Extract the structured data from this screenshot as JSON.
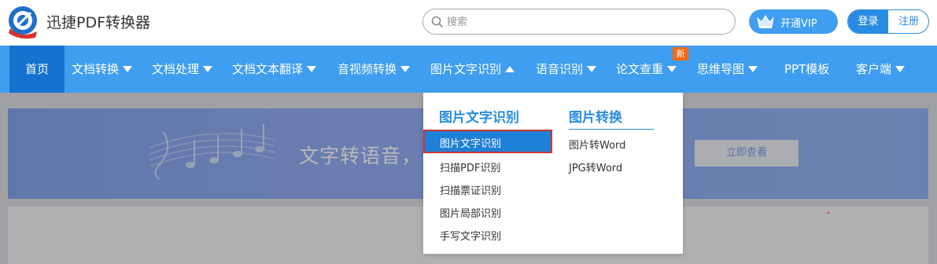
{
  "header": {
    "app_title": "迅捷PDF转换器",
    "search_placeholder": "搜索",
    "vip_label": "开通VIP",
    "login_label": "登录",
    "register_label": "注册"
  },
  "nav": {
    "items": [
      {
        "label": "首页",
        "dropdown": false
      },
      {
        "label": "文档转换",
        "dropdown": true
      },
      {
        "label": "文档处理",
        "dropdown": true
      },
      {
        "label": "文档文本翻译",
        "dropdown": true
      },
      {
        "label": "音视频转换",
        "dropdown": true
      },
      {
        "label": "图片文字识别",
        "dropdown": true,
        "open": true
      },
      {
        "label": "语音识别",
        "dropdown": true
      },
      {
        "label": "论文查重",
        "dropdown": true
      },
      {
        "label": "思维导图",
        "dropdown": true
      },
      {
        "label": "PPT模板",
        "dropdown": false
      },
      {
        "label": "客户端",
        "dropdown": true
      }
    ],
    "new_badge": "新"
  },
  "dropdown": {
    "col1": {
      "heading": "图片文字识别",
      "items": [
        "图片文字识别",
        "扫描PDF识别",
        "扫描票证识别",
        "图片局部识别",
        "手写文字识别"
      ],
      "active_index": 0
    },
    "col2": {
      "heading": "图片转换",
      "items": [
        "图片转Word",
        "JPG转Word"
      ]
    }
  },
  "banner": {
    "text": "文字转语音，",
    "button_label": "立即查看"
  },
  "colors": {
    "nav_bg": "#3f9ef0",
    "nav_active_bg": "#1573cf",
    "accent": "#2a8ce0",
    "badge_orange": "#f26a18",
    "active_item_border": "#d0352f"
  }
}
